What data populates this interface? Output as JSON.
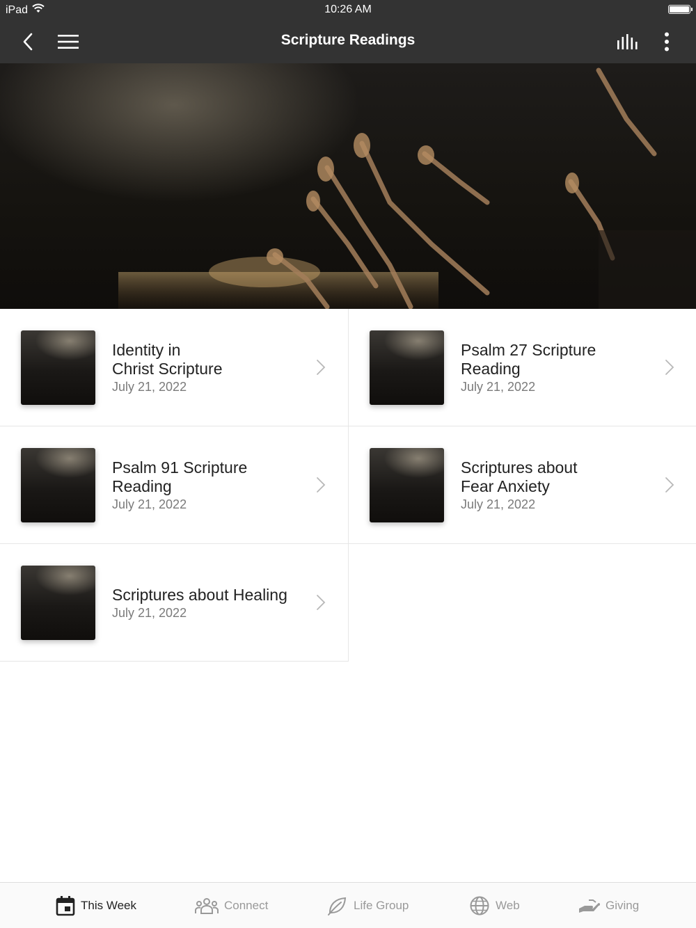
{
  "status_bar": {
    "carrier": "iPad",
    "time": "10:26 AM"
  },
  "nav": {
    "title": "Scripture Readings",
    "back_icon": "chevron-left-icon",
    "menu_icon": "hamburger-icon",
    "audio_icon": "equalizer-icon",
    "more_icon": "more-vertical-icon"
  },
  "items": [
    {
      "title_line1": "Identity in",
      "title_line2": "Christ Scripture",
      "date": "July 21, 2022"
    },
    {
      "title_line1": "Psalm 27 Scripture",
      "title_line2": "Reading",
      "date": "July 21, 2022"
    },
    {
      "title_line1": "Psalm 91 Scripture",
      "title_line2": "Reading",
      "date": "July 21, 2022"
    },
    {
      "title_line1": "Scriptures about",
      "title_line2": "Fear Anxiety",
      "date": "July 21, 2022"
    },
    {
      "title_line1": "Scriptures about Healing",
      "title_line2": "",
      "date": "July 21, 2022"
    }
  ],
  "tabs": [
    {
      "label": "This Week",
      "icon": "calendar-icon",
      "active": true
    },
    {
      "label": "Connect",
      "icon": "people-icon",
      "active": false
    },
    {
      "label": "Life Group",
      "icon": "leaf-icon",
      "active": false
    },
    {
      "label": "Web",
      "icon": "globe-icon",
      "active": false
    },
    {
      "label": "Giving",
      "icon": "giving-hand-icon",
      "active": false
    }
  ],
  "colors": {
    "header_bg": "#333333",
    "tab_active": "#222222",
    "tab_inactive": "#999999"
  }
}
